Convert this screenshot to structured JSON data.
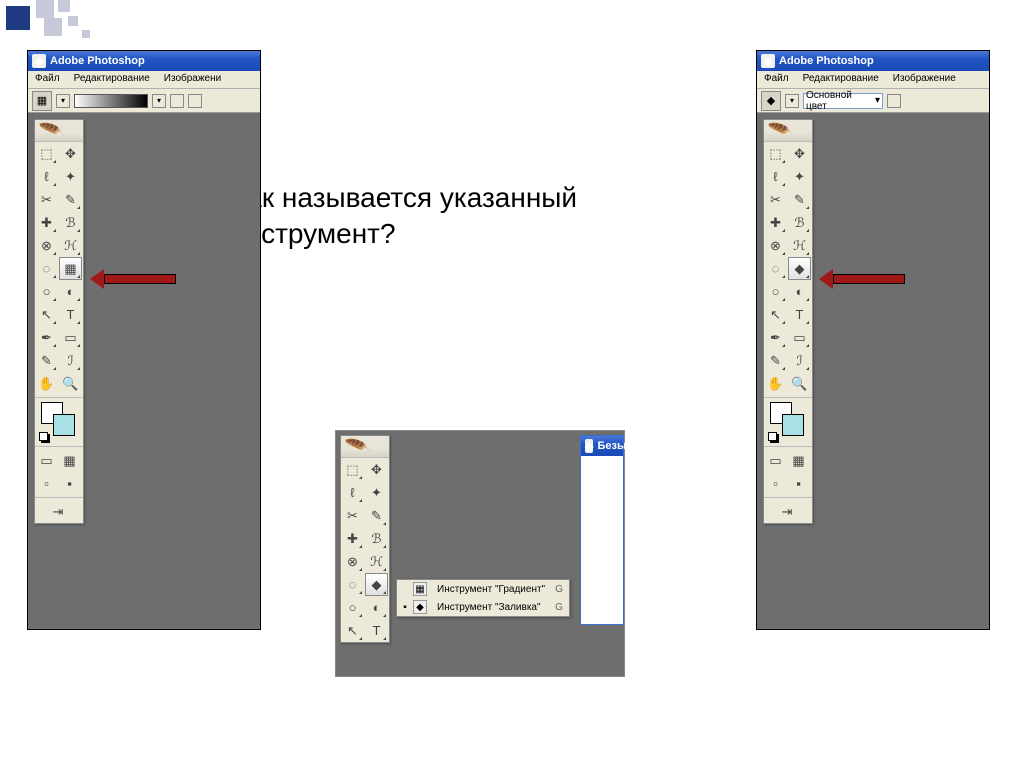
{
  "decor": {},
  "question": {
    "line1": "Как называется указанный",
    "line2": "инструмент?"
  },
  "photoshop": {
    "title": "Adobe Photoshop",
    "menu": {
      "file": "Файл",
      "edit": "Редактирование",
      "image": "Изображение",
      "image_short": "Изображени"
    },
    "options_right": {
      "foreground_label": "Основной цвет"
    },
    "document_title": "Безы",
    "tools": {
      "marquee": "⬚",
      "move": "✥",
      "lasso": "ℓ",
      "wand": "✦",
      "crop": "✂",
      "slice": "✎",
      "healing": "✚",
      "brush": "ℬ",
      "stamp": "⊗",
      "history": "ℋ",
      "eraser": "◌",
      "gradient": "▦",
      "bucket": "◆",
      "blur": "○",
      "dodge": "◐",
      "path": "↖",
      "type": "T",
      "pen": "✒",
      "shape": "▭",
      "notes": "✎",
      "eyedrop": "ℐ",
      "hand": "✋",
      "zoom": "🔍",
      "jump": "⇥"
    },
    "flyout": {
      "gradient": {
        "label": "Инструмент \"Градиент\"",
        "key": "G"
      },
      "bucket": {
        "label": "Инструмент \"Заливка\"",
        "key": "G"
      }
    }
  }
}
